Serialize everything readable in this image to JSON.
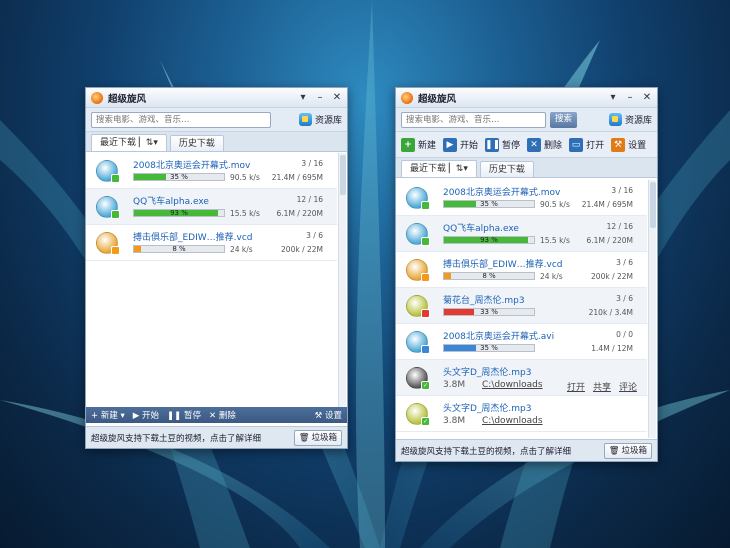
{
  "win1": {
    "title": "超级旋风",
    "controls": [
      "▾",
      "–",
      "✕"
    ],
    "search_placeholder": "搜索电影、游戏、音乐…",
    "library": "资源库",
    "tabs": [
      {
        "label": "最近下载 ▏⇅▾"
      },
      {
        "label": "历史下载"
      }
    ],
    "items": [
      {
        "name": "2008北京奥运会开幕式.mov",
        "pct": "35 %",
        "fill": 0.35,
        "speed": "90.5 k/s",
        "count": "3 / 16",
        "size": "21.4M / 695M",
        "color": "#47b939"
      },
      {
        "name": "QQ飞车alpha.exe",
        "pct": "93 %",
        "fill": 0.93,
        "speed": "15.5 k/s",
        "count": "12 / 16",
        "size": "6.1M / 220M",
        "color": "#47b939"
      },
      {
        "name": "搏击俱乐部_EDIW…推荐.vcd",
        "pct": "8 %",
        "fill": 0.08,
        "speed": "24 k/s",
        "count": "3 / 6",
        "size": "200k / 22M",
        "color": "#f39a1e"
      }
    ],
    "bottom": {
      "new": "+ 新建 ▾",
      "start": "▶ 开始",
      "pause": "❚❚ 暂停",
      "delete": "✕ 删除",
      "settings": "⚒ 设置"
    },
    "status": "超级旋风支持下载土豆的视频，点击了解详细",
    "trash": "垃圾箱"
  },
  "win2": {
    "title": "超级旋风",
    "controls": [
      "▾",
      "–",
      "✕"
    ],
    "search_placeholder": "搜索电影、游戏、音乐…",
    "search_button": "搜索",
    "library": "资源库",
    "toolbar": {
      "new": "新建",
      "start": "开始",
      "pause": "暂停",
      "delete": "删除",
      "open": "打开",
      "settings": "设置"
    },
    "tabs": [
      {
        "label": "最近下载 ▏⇅▾"
      },
      {
        "label": "历史下载"
      }
    ],
    "items": [
      {
        "name": "2008北京奥运会开幕式.mov",
        "pct": "35 %",
        "fill": 0.35,
        "speed": "90.5 k/s",
        "count": "3 / 16",
        "size": "21.4M / 695M",
        "color": "#47b939"
      },
      {
        "name": "QQ飞车alpha.exe",
        "pct": "93 %",
        "fill": 0.93,
        "speed": "15.5 k/s",
        "count": "12 / 16",
        "size": "6.1M / 220M",
        "color": "#47b939"
      },
      {
        "name": "搏击俱乐部_EDIW…推荐.vcd",
        "pct": "8 %",
        "fill": 0.08,
        "speed": "24 k/s",
        "count": "3 / 6",
        "size": "200k / 22M",
        "color": "#f39a1e"
      },
      {
        "name": "菊花台_周杰伦.mp3",
        "pct": "33 %",
        "fill": 0.33,
        "speed": "",
        "count": "3 / 6",
        "size": "210k / 3.4M",
        "color": "#e23a32"
      },
      {
        "name": "2008北京奥运会开幕式.avi",
        "pct": "35 %",
        "fill": 0.35,
        "speed": "",
        "count": "0 / 0",
        "size": "1.4M / 12M",
        "color": "#3b86d6"
      }
    ],
    "finished": [
      {
        "name": "头文字D_周杰伦.mp3",
        "size": "3.8M",
        "dir": "C:\\downloads",
        "actions": [
          "打开",
          "共享",
          "评论"
        ]
      },
      {
        "name": "头文字D_周杰伦.mp3",
        "size": "3.8M",
        "dir": "C:\\downloads"
      }
    ],
    "status": "超级旋风支持下载土豆的视频，点击了解详细",
    "trash": "垃圾箱"
  }
}
